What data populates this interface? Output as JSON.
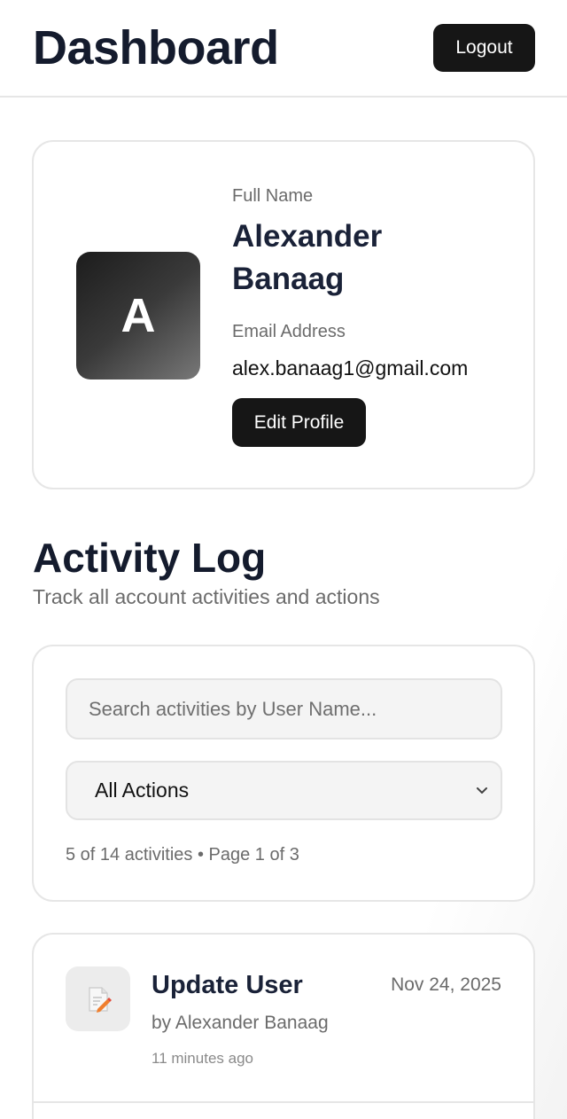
{
  "header": {
    "title": "Dashboard",
    "logout_label": "Logout"
  },
  "profile": {
    "avatar_initial": "A",
    "full_name_label": "Full Name",
    "full_name": "Alexander Banaag",
    "email_label": "Email Address",
    "email": "alex.banaag1@gmail.com",
    "edit_label": "Edit Profile"
  },
  "activity_log": {
    "title": "Activity Log",
    "subtitle": "Track all account activities and actions",
    "search_placeholder": "Search activities by User Name...",
    "filter_selected": "All Actions",
    "count_text": "5 of 14 activities • Page 1 of 3",
    "items": [
      {
        "icon": "memo-pencil-icon",
        "title": "Update User",
        "date": "Nov 24, 2025",
        "by": "by Alexander Banaag",
        "time_ago": "11 minutes ago"
      }
    ]
  },
  "colors": {
    "button_bg": "#161616",
    "heading": "#141b2d",
    "muted": "#6b6b6b",
    "border": "#e6e6e6"
  }
}
